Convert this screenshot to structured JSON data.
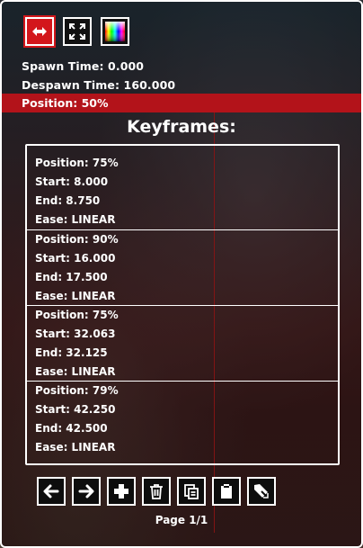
{
  "toolbar": {
    "buttons": [
      {
        "icon": "horizontal-arrows-icon",
        "active": true
      },
      {
        "icon": "expand-icon",
        "active": false
      },
      {
        "icon": "color-spectrum-icon",
        "active": false
      }
    ]
  },
  "info": {
    "spawn_time": "Spawn Time: 0.000",
    "despawn_time": "Despawn Time: 160.000",
    "position": "Position: 50%"
  },
  "keyframes": {
    "title": "Keyframes:",
    "items": [
      {
        "position": "Position: 75%",
        "start": "Start: 8.000",
        "end": "End: 8.750",
        "ease": "Ease: LINEAR"
      },
      {
        "position": "Position: 90%",
        "start": "Start: 16.000",
        "end": "End: 17.500",
        "ease": "Ease: LINEAR"
      },
      {
        "position": "Position: 75%",
        "start": "Start: 32.063",
        "end": "End: 32.125",
        "ease": "Ease: LINEAR"
      },
      {
        "position": "Position: 79%",
        "start": "Start: 42.250",
        "end": "End: 42.500",
        "ease": "Ease: LINEAR"
      }
    ]
  },
  "actions": [
    {
      "icon": "arrow-left-icon"
    },
    {
      "icon": "arrow-right-icon"
    },
    {
      "icon": "plus-icon"
    },
    {
      "icon": "trash-icon"
    },
    {
      "icon": "copy-icon"
    },
    {
      "icon": "paste-icon"
    },
    {
      "icon": "pointer-icon"
    }
  ],
  "pagination": {
    "label": "Page 1/1"
  },
  "colors": {
    "accent": "#d3161b",
    "border": "#ffffff"
  }
}
